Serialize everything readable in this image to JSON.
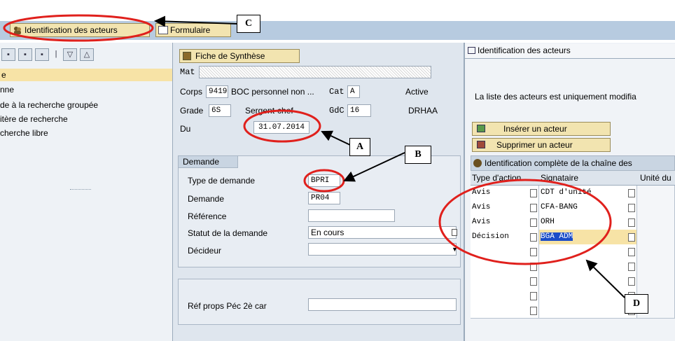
{
  "toolbar": {
    "identification_button": "Identification des acteurs",
    "formulaire_button": "Formulaire"
  },
  "callouts": {
    "a": "A",
    "b": "B",
    "c": "C",
    "d": "D"
  },
  "left_panel": {
    "selected_item": "e",
    "items": [
      "nne",
      "de à la recherche groupée",
      "itère de recherche",
      "cherche libre"
    ]
  },
  "mid_panel": {
    "fiche_button": "Fiche de Synthèse",
    "mat_label": "Mat",
    "corps_label": "Corps",
    "corps_value": "9419",
    "corps_desc": "BOC personnel non ...",
    "cat_label": "Cat",
    "cat_value": "A",
    "status": "Active",
    "grade_label": "Grade",
    "grade_value": "6S",
    "grade_desc": "Sergent-chef",
    "gdc_label": "GdC",
    "gdc_value": "16",
    "unit": "DRHAA",
    "du_label": "Du",
    "du_value": "31.07.2014",
    "demande_group": {
      "title": "Demande",
      "type_label": "Type de demande",
      "type_value": "BPRI",
      "demande_label": "Demande",
      "demande_value": "PR04",
      "reference_label": "Référence",
      "reference_value": "",
      "statut_label": "Statut de la demande",
      "statut_value": "En cours",
      "decideur_label": "Décideur",
      "decideur_value": ""
    },
    "ref_props_label": "Réf props Péc 2è car",
    "ref_props_value": ""
  },
  "right_panel": {
    "title": "Identification des acteurs",
    "info_text": "La liste des acteurs est uniquement modifia",
    "insert_button": "Insérer un acteur",
    "delete_button": "Supprimer un acteur",
    "chain_title": "Identification complète de la chaîne des",
    "columns": [
      "Type d'action",
      "Signataire",
      "Unité du"
    ],
    "rows": [
      {
        "type": "Avis",
        "signataire": "CDT d'unité"
      },
      {
        "type": "Avis",
        "signataire": "CFA-BANG"
      },
      {
        "type": "Avis",
        "signataire": "ORH"
      },
      {
        "type": "Décision",
        "signataire": "BGA ADM"
      },
      {
        "type": "",
        "signataire": ""
      },
      {
        "type": "",
        "signataire": ""
      },
      {
        "type": "",
        "signataire": ""
      },
      {
        "type": "",
        "signataire": ""
      },
      {
        "type": "",
        "signataire": ""
      }
    ]
  },
  "colors": {
    "toolbar_bg": "#b7cbe0",
    "button_bg": "#f2e4b0",
    "annotation_red": "#e0201c",
    "selection_yellow": "#f7e3a6",
    "highlight_blue": "#1a4cc8"
  }
}
